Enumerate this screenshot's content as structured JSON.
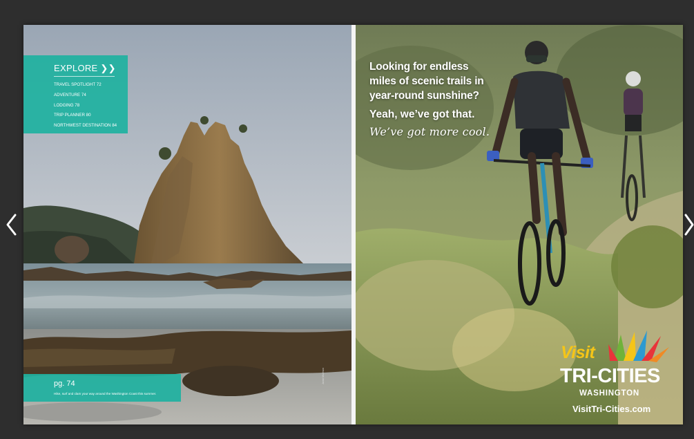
{
  "viewer": {
    "prev_icon": "chevron-left-icon",
    "next_icon": "chevron-right-icon"
  },
  "left_page": {
    "explore": {
      "title": "EXPLORE ❯❯",
      "items": [
        "TRAVEL SPOTLIGHT  72",
        "ADVENTURE  74",
        "LODGING  78",
        "TRIP PLANNER  80",
        "NORTHWEST DESTINATION  84"
      ]
    },
    "page_ref": {
      "number": "pg. 74",
      "caption": "Hike, surf and clam your way around the Washington Coast this summer."
    },
    "photo_credit": "Jamie Morrison"
  },
  "right_page": {
    "headline_lines": [
      "Looking for endless",
      "miles of scenic trails in",
      "year-round sunshine?"
    ],
    "tagline": "Yeah, we’ve got that.",
    "cool_line": "We’ve got more cool.",
    "logo": {
      "visit": "Visit",
      "name": "TRI-CITIES",
      "state": "WASHINGTON",
      "url": "VisitTri-Cities.com"
    }
  },
  "colors": {
    "teal_box": "#20b2a0",
    "viewer_bg": "#2e2e2e",
    "logo_yellow": "#f5c518"
  }
}
